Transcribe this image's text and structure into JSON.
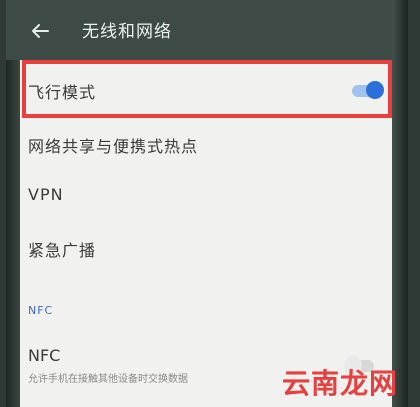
{
  "appbar": {
    "title": "无线和网络",
    "back_icon": "back-arrow-icon"
  },
  "rows": [
    {
      "label": "飞行模式",
      "toggle": "on"
    },
    {
      "label": "网络共享与便携式热点"
    },
    {
      "label": "VPN"
    },
    {
      "label": "紧急广播"
    }
  ],
  "section_header": "NFC",
  "nfc": {
    "title": "NFC",
    "subtitle": "允许手机在接触其他设备时交换数据",
    "toggle": "off"
  },
  "watermark": "云南龙网",
  "colors": {
    "accent": "#2b6fdb",
    "highlight_border": "#e8403f",
    "appbar": "#3d4a46"
  }
}
